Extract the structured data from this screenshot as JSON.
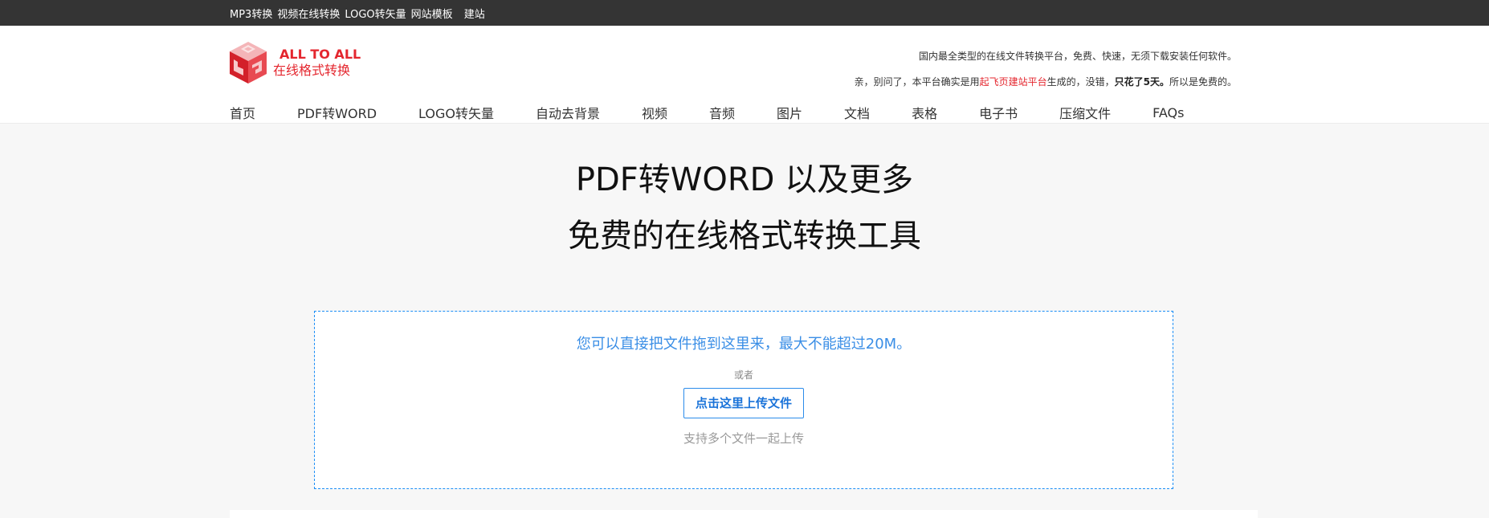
{
  "topbar": {
    "links": [
      "MP3转换",
      "视频在线转换",
      "LOGO转矢量",
      "网站模板",
      "建站"
    ]
  },
  "logo": {
    "line1": "ALL TO ALL",
    "line2": "在线格式转换",
    "brand_color": "#e4262e"
  },
  "slogan": {
    "line1": "国内最全类型的在线文件转换平台，免费、快速，无须下载安装任何软件。",
    "line2_prefix": "亲，别问了，本平台确实是用",
    "line2_link": "起飞页建站平台",
    "line2_middle": "生成的，没错，",
    "line2_bold": "只花了5天。",
    "line2_suffix": "所以是免费的。"
  },
  "nav": {
    "items": [
      "首页",
      "PDF转WORD",
      "LOGO转矢量",
      "自动去背景",
      "视频",
      "音频",
      "图片",
      "文档",
      "表格",
      "电子书",
      "压缩文件",
      "FAQs"
    ]
  },
  "hero": {
    "title": "PDF转WORD 以及更多",
    "subtitle": "免费的在线格式转换工具"
  },
  "upload": {
    "drop_tip": "您可以直接把文件拖到这里来，最大不能超过20M。",
    "or_text": "或者",
    "button_label": "点击这里上传文件",
    "multi_tip": "支持多个文件一起上传",
    "accent_color": "#1c8ef5"
  }
}
